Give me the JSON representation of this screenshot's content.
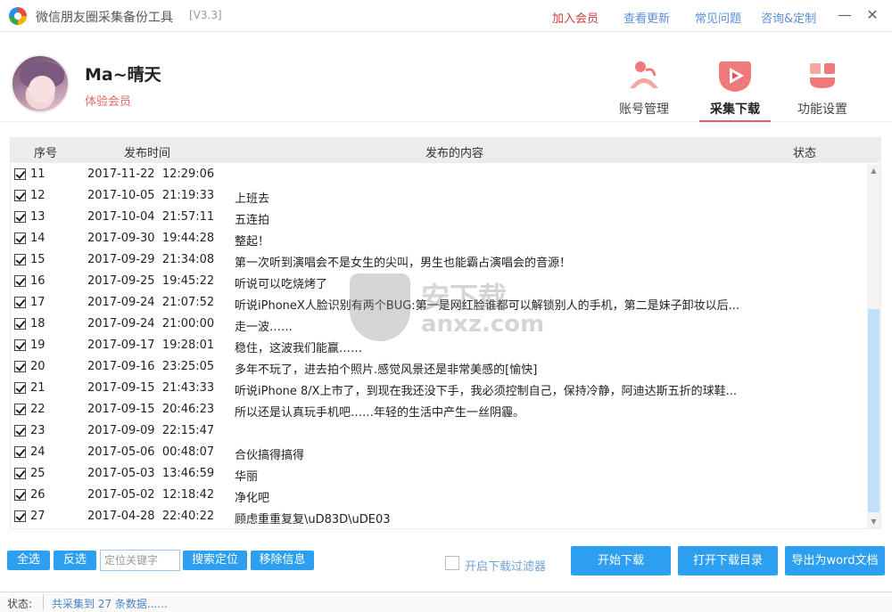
{
  "titlebar": {
    "title": "微信朋友圈采集备份工具",
    "version": "[V3.3]",
    "links": [
      "加入会员",
      "查看更新",
      "常见问题",
      "咨询&定制"
    ],
    "minimize": "—",
    "close": "✕"
  },
  "user": {
    "name": "Ma~晴天",
    "level": "体验会员"
  },
  "nav": [
    {
      "label": "账号管理",
      "icon": "account-icon"
    },
    {
      "label": "采集下载",
      "icon": "download-play-icon",
      "active": true
    },
    {
      "label": "功能设置",
      "icon": "settings-icon"
    }
  ],
  "table": {
    "headers": [
      "序号",
      "发布时间",
      "发布的内容",
      "状态"
    ],
    "rows": [
      {
        "seq": "11",
        "time": "2017-11-22  12:29:06",
        "content": ""
      },
      {
        "seq": "12",
        "time": "2017-10-05  21:19:33",
        "content": "上班去"
      },
      {
        "seq": "13",
        "time": "2017-10-04  21:57:11",
        "content": "五连拍"
      },
      {
        "seq": "14",
        "time": "2017-09-30  19:44:28",
        "content": "整起！"
      },
      {
        "seq": "15",
        "time": "2017-09-29  21:34:08",
        "content": "第一次听到演唱会不是女生的尖叫，男生也能霸占演唱会的音源！"
      },
      {
        "seq": "16",
        "time": "2017-09-25  19:45:22",
        "content": "听说可以吃烧烤了"
      },
      {
        "seq": "17",
        "time": "2017-09-24  21:07:52",
        "content": "听说iPhoneX人脸识别有两个BUG:第一是网红脸谁都可以解锁别人的手机，第二是妹子卸妆以后..."
      },
      {
        "seq": "18",
        "time": "2017-09-24  21:00:00",
        "content": "走一波……"
      },
      {
        "seq": "19",
        "time": "2017-09-17  19:28:01",
        "content": "稳住，这波我们能赢……"
      },
      {
        "seq": "20",
        "time": "2017-09-16  23:25:05",
        "content": "多年不玩了，进去拍个照片.感觉风景还是非常美感的[愉快]"
      },
      {
        "seq": "21",
        "time": "2017-09-15  21:43:33",
        "content": "听说iPhone 8/X上市了，到现在我还没下手，我必须控制自己，保持冷静，阿迪达斯五折的球鞋..."
      },
      {
        "seq": "22",
        "time": "2017-09-15  20:46:23",
        "content": "所以还是认真玩手机吧……年轻的生活中产生一丝阴霾。"
      },
      {
        "seq": "23",
        "time": "2017-09-09  22:15:47",
        "content": ""
      },
      {
        "seq": "24",
        "time": "2017-05-06  00:48:07",
        "content": "合伙搞得搞得"
      },
      {
        "seq": "25",
        "time": "2017-05-03  13:46:59",
        "content": "华丽"
      },
      {
        "seq": "26",
        "time": "2017-05-02  12:18:42",
        "content": "净化吧"
      },
      {
        "seq": "27",
        "time": "2017-04-28  22:40:22",
        "content": "顾虑重重复复\\uD83D\\uDE03"
      }
    ]
  },
  "watermark": {
    "main": "安下载",
    "sub": "anxz.com"
  },
  "toolbar": {
    "select_all": "全选",
    "invert": "反选",
    "search_placeholder": "定位关键字",
    "search_button": "搜索定位",
    "remove_button": "移除信息",
    "filter_label": "开启下载过滤器",
    "start_download": "开始下载",
    "open_dir": "打开下载目录",
    "export_word": "导出为word文档"
  },
  "status": {
    "label": "状态:",
    "text": "共采集到 27 条数据......"
  },
  "colors": {
    "accent": "#2d9ff0",
    "vip": "#d23a3a",
    "active_tab": "#e85a6f"
  }
}
